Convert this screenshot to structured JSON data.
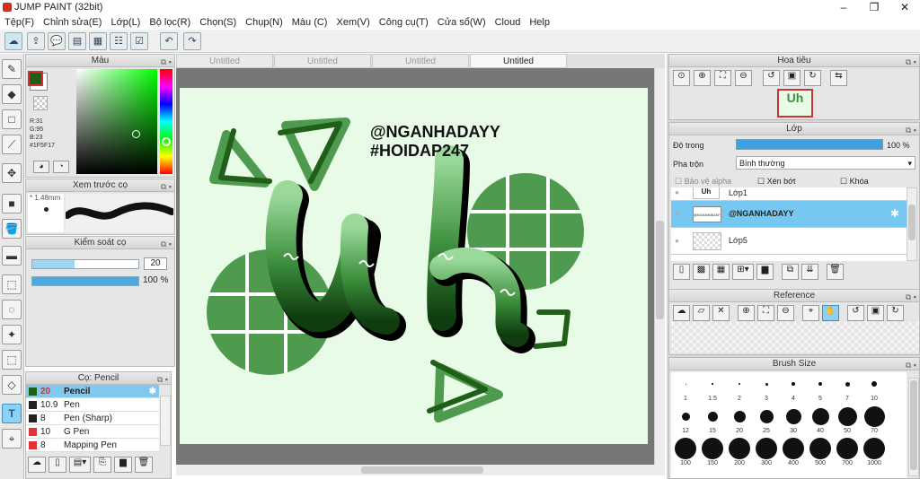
{
  "app": {
    "title": "JUMP PAINT (32bit)",
    "controls": [
      "–",
      "❐",
      "✕"
    ]
  },
  "menu": [
    "Tệp(F)",
    "Chỉnh sửa(E)",
    "Lớp(L)",
    "Bộ lọc(R)",
    "Chọn(S)",
    "Chụp(N)",
    "Màu (C)",
    "Xem(V)",
    "Công cụ(T)",
    "Cửa sổ(W)",
    "Cloud",
    "Help"
  ],
  "color_panel": {
    "title": "Màu",
    "r": "R:31",
    "g": "G:95",
    "b": "B:23",
    "hex": "#1F5F17",
    "fg": "#1F5F17"
  },
  "brush_preview": {
    "title": "Xem trước cọ",
    "size": "1.48mm"
  },
  "brush_control": {
    "title": "Kiểm soát cọ",
    "size_value": "20",
    "opacity_value": "100 %",
    "opacity_pct": 100
  },
  "brush_list": {
    "title": "Cọ: Pencil",
    "items": [
      {
        "size": "20",
        "name": "Pencil",
        "color": "#1f5f17",
        "selected": true
      },
      {
        "size": "10.9",
        "name": "Pen",
        "color": "#222222",
        "selected": false
      },
      {
        "size": "8",
        "name": "Pen (Sharp)",
        "color": "#222222",
        "selected": false
      },
      {
        "size": "10",
        "name": "G Pen",
        "color": "#e03333",
        "selected": false
      },
      {
        "size": "8",
        "name": "Mapping Pen",
        "color": "#e03333",
        "selected": false
      }
    ]
  },
  "tabs": [
    "Untitled",
    "Untitled",
    "Untitled",
    "Untitled"
  ],
  "artwork": {
    "line1": "@NGANHADAYY",
    "line2": "#HOIDAP247",
    "lettering": "Uh"
  },
  "navigator": {
    "title": "Hoa tiêu"
  },
  "layers": {
    "title": "Lớp",
    "opacity_label": "Độ trong",
    "opacity_value": "100 %",
    "opacity_pct": 100,
    "blend_label": "Pha trộn",
    "blend_value": "Bình thường",
    "protect_alpha": "Bảo vệ alpha",
    "clipping": "Xén bớt",
    "lock": "Khóa",
    "items": [
      {
        "name": "Lớp1",
        "selected": false,
        "thumb": "Uh"
      },
      {
        "name": "@NGANHADAYY",
        "selected": true,
        "thumb": "@NGANHADAYY"
      },
      {
        "name": "Lớp5",
        "selected": false,
        "thumb": ""
      }
    ]
  },
  "reference": {
    "title": "Reference"
  },
  "brush_size": {
    "title": "Brush Size",
    "sizes": [
      "1",
      "1.5",
      "2",
      "3",
      "4",
      "5",
      "7",
      "10",
      "12",
      "15",
      "20",
      "25",
      "30",
      "40",
      "50",
      "70",
      "100",
      "150",
      "200",
      "300",
      "400",
      "500",
      "700",
      "1000"
    ]
  }
}
